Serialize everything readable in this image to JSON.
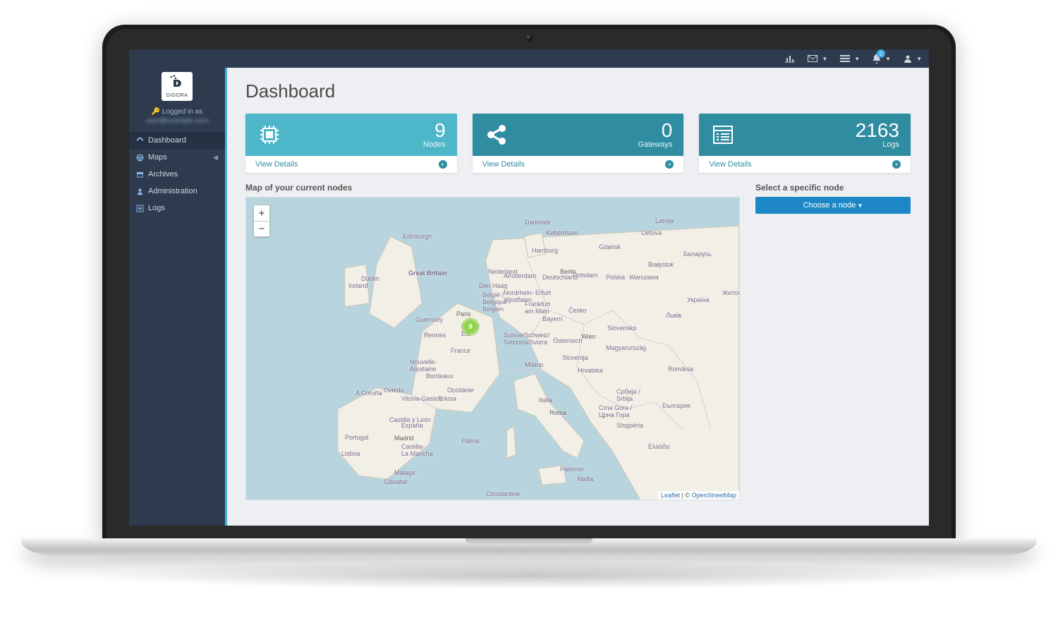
{
  "brand": {
    "name": "DIGORA"
  },
  "topbar": {
    "notifications_count": 0
  },
  "sidebar": {
    "logged_in_label": "Logged in as",
    "logged_in_email": "user@example.com",
    "items": [
      {
        "label": "Dashboard",
        "active": true
      },
      {
        "label": "Maps",
        "has_children": true
      },
      {
        "label": "Archives"
      },
      {
        "label": "Administration"
      },
      {
        "label": "Logs"
      }
    ]
  },
  "page": {
    "title": "Dashboard"
  },
  "cards": {
    "nodes": {
      "value": "9",
      "label": "Nodes",
      "details_label": "View Details"
    },
    "gateways": {
      "value": "0",
      "label": "Gateways",
      "details_label": "View Details"
    },
    "logs": {
      "value": "2163",
      "label": "Logs",
      "details_label": "View Details"
    }
  },
  "map": {
    "title": "Map of your current nodes",
    "marker_value": "9",
    "attribution_lib": "Leaflet",
    "attribution_sep": " | © ",
    "attribution_src": "OpenStreetMap",
    "labels": {
      "great_britain": "Great Britain",
      "ireland": "Ireland",
      "france": "France",
      "paris": "Paris",
      "deutschland": "Deutschland",
      "berlin": "Berlin",
      "polska": "Polska",
      "italia": "Italia",
      "espana": "España",
      "portugal": "Portugal",
      "nederland": "Nederland",
      "belgie": "België /\nBelgique /\nBelgien",
      "osterreich": "Österreich",
      "suisse": "Suisse/Schweiz/\nSvizzera/Svizra",
      "cesko": "Česko",
      "slovensko": "Slovensko",
      "magyar": "Magyarország",
      "romania": "România",
      "ukraine": "Україна",
      "belarus": "Беларусь",
      "lietuva": "Lietuva",
      "latvija": "Latvija",
      "ellada": "Ελλάδα",
      "hrvatska": "Hrvatska",
      "srbija": "Србија /\nSrbija",
      "cg": "Crna Gora /\nЦрна Гора",
      "bg": "България",
      "shqiperia": "Shqipëria",
      "malta": "Malta",
      "kobenhavn": "København",
      "danmark": "Danmark",
      "edinburgh": "Edinburgh",
      "dublin": "Dublin",
      "roma": "Roma",
      "milano": "Milano",
      "madrid": "Madrid",
      "rennes": "Rennes",
      "bordeaux": "Bordeaux",
      "occitanie": "Occitànie",
      "warszawa": "Warszawa",
      "wien": "Wien",
      "amsterdam": "Amsterdam",
      "denhaag": "Den Haag",
      "gibraltar": "Gibraltar",
      "acoruna": "A Coruña",
      "oviedo": "Oviedo",
      "vitoria": "Vitoria-Gasteiz",
      "lisboa": "Lisboa",
      "toulouse": "Tolosa",
      "palermo": "Palermo",
      "constantine": "Constantine",
      "grand_est": "Grand\nEst",
      "nordrhein": "Nordrhein-\nWestfalen",
      "frankfurt": "Frankfurt\nam Main",
      "erfurt": "Erfurt",
      "bayern": "Bayern",
      "potsdam": "Potsdam",
      "hamburg": "Hamburg",
      "slovenija": "Slovenija",
      "lviv": "Львів",
      "zh": "Житомир",
      "bialystok": "Białystok",
      "gdansk": "Gdańsk",
      "guernsey": "Guernsey",
      "nouvelle": "Nouvelle-\nAquitaine",
      "castilla_leon": "Castilla y León",
      "castilla_mancha": "Castilla-\nLa Mancha",
      "malaga": "Málaga",
      "palma": "Palma"
    }
  },
  "select_panel": {
    "title": "Select a specific node",
    "button_label": "Choose a node"
  }
}
